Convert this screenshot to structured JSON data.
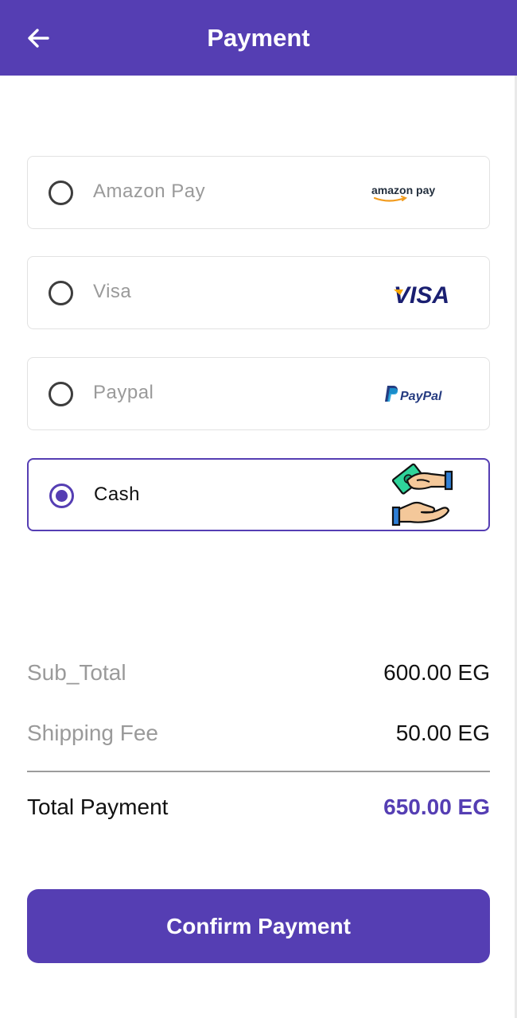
{
  "header": {
    "title": "Payment",
    "back_icon": "arrow-left-icon"
  },
  "payment_methods": [
    {
      "label": "Amazon Pay",
      "selected": false,
      "logo": "amazon-pay-logo",
      "logo_text": "amazon pay"
    },
    {
      "label": "Visa",
      "selected": false,
      "logo": "visa-logo",
      "logo_text": "VISA"
    },
    {
      "label": "Paypal",
      "selected": false,
      "logo": "paypal-logo",
      "logo_text": "PayPal"
    },
    {
      "label": "Cash",
      "selected": true,
      "logo": "cash-hands-icon"
    }
  ],
  "summary": {
    "subtotal_label": "Sub_Total",
    "subtotal_value": "600.00 EG",
    "shipping_label": "Shipping Fee",
    "shipping_value": "50.00 EG",
    "total_label": "Total Payment",
    "total_value": "650.00 EG"
  },
  "confirm_button": {
    "label": "Confirm Payment"
  },
  "colors": {
    "accent": "#553eb3",
    "muted_text": "#9a9a9a",
    "border": "#e2e2e2"
  }
}
